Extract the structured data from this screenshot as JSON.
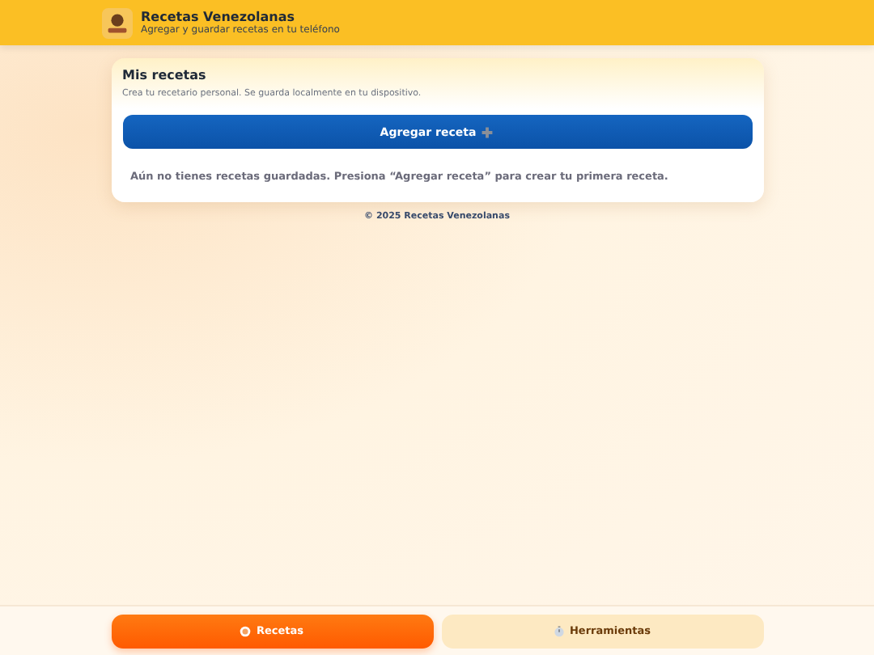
{
  "header": {
    "title": "Recetas Venezolanas",
    "subtitle": "Agregar y guardar recetas en tu teléfono"
  },
  "card": {
    "title": "Mis recetas",
    "description": "Crea tu recetario personal. Se guarda localmente en tu dispositivo.",
    "add_button": "Agregar receta",
    "empty_message": "Aún no tienes recetas guardadas. Presiona “Agregar receta” para crear tu primera receta."
  },
  "footer": "© 2025 Recetas Venezolanas",
  "tabs": [
    {
      "label": "Recetas",
      "kind": "plate",
      "selected": true
    },
    {
      "label": "Herramientas",
      "kind": "timer",
      "selected": false
    }
  ]
}
